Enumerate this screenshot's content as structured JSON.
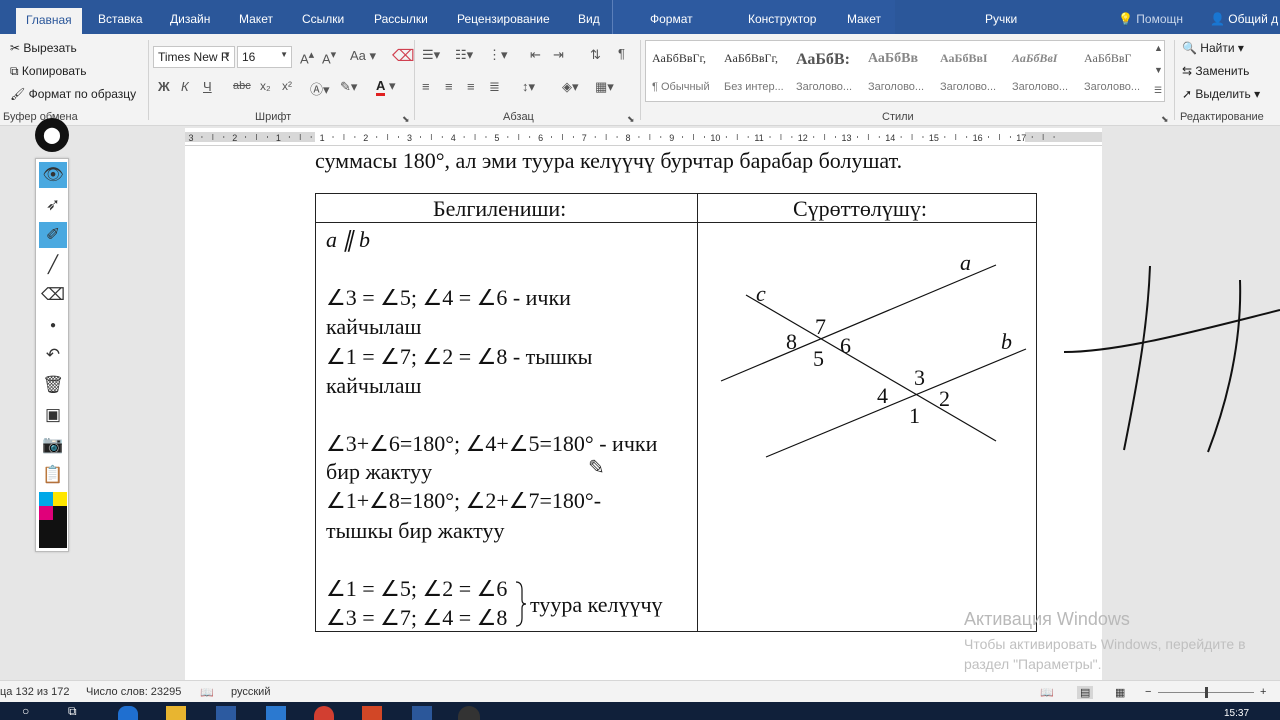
{
  "tabs": {
    "items": [
      "Главная",
      "Вставка",
      "Дизайн",
      "Макет",
      "Ссылки",
      "Рассылки",
      "Рецензирование",
      "Вид"
    ],
    "context_items": [
      "Формат",
      "Конструктор",
      "Макет",
      "Ручки"
    ],
    "help": "Помощн",
    "share": "Общий д"
  },
  "ribbon": {
    "clipboard": {
      "cut": "Вырезать",
      "copy": "Копировать",
      "format_painter": "Формат по образцу",
      "label": "Буфер обмена"
    },
    "font": {
      "name": "Times New R",
      "size": "16",
      "label": "Шрифт",
      "grow": "A",
      "shrink": "A",
      "case": "Aa",
      "bold": "Ж",
      "italic": "К",
      "underline": "Ч",
      "strike": "abc",
      "sub": "x₂",
      "sup": "x²",
      "color_letter": "A"
    },
    "paragraph": {
      "label": "Абзац"
    },
    "styles": {
      "label": "Стили",
      "items": [
        {
          "sample": "АаБбВвГг,",
          "name": "¶ Обычный"
        },
        {
          "sample": "АаБбВвГг,",
          "name": "Без интер..."
        },
        {
          "sample": "АаБбВ:",
          "name": "Заголово..."
        },
        {
          "sample": "АаБбВв",
          "name": "Заголово..."
        },
        {
          "sample": "АаБбВвІ",
          "name": "Заголово..."
        },
        {
          "sample": "АаБбВвІ",
          "name": "Заголово..."
        },
        {
          "sample": "АаБбВвГ",
          "name": "Заголово..."
        }
      ]
    },
    "editing": {
      "find": "Найти",
      "replace": "Заменить",
      "select": "Выделить",
      "label": "Редактирование"
    }
  },
  "ruler": {
    "numbers": [
      "3",
      "2",
      "1",
      "1",
      "2",
      "3",
      "4",
      "5",
      "6",
      "7",
      "8",
      "9",
      "10",
      "11",
      "12",
      "13",
      "14",
      "15",
      "16",
      "17"
    ]
  },
  "document": {
    "top_line": "суммасы 180°, ал эми туура келүүчү бурчтар барабар болушат.",
    "table": {
      "header_left": "Белгилениши:",
      "header_right": "Сүрөттөлүшү:",
      "left_lines": [
        "a ∥ b",
        "∠3 = ∠5; ∠4 = ∠6 - ички",
        "кайчылаш",
        "∠1 = ∠7; ∠2 = ∠8 - тышкы",
        "кайчылаш",
        "∠3+∠6=180°; ∠4+∠5=180° - ички",
        "бир жактуу",
        "∠1+∠8=180°; ∠2+∠7=180°-",
        "тышкы бир жактуу",
        "∠1 = ∠5; ∠2 = ∠6",
        "∠3 = ∠7; ∠4 = ∠8"
      ],
      "bracket_text": "туура келүүчү",
      "figure_labels": {
        "a": "a",
        "b": "b",
        "c": "c",
        "n1": "1",
        "n2": "2",
        "n3": "3",
        "n4": "4",
        "n5": "5",
        "n6": "6",
        "n7": "7",
        "n8": "8"
      }
    }
  },
  "watermark": {
    "title": "Активация Windows",
    "text": "Чтобы активировать Windows, перейдите в раздел \"Параметры\"."
  },
  "status": {
    "page": "ца 132 из 172",
    "words": "Число слов: 23295",
    "language": "русский"
  },
  "taskbar": {
    "time": "15:37"
  },
  "colors": {
    "accent": "#2b579a",
    "toolbar_selected": "#4aa9e0",
    "font_color": "#e02020"
  }
}
